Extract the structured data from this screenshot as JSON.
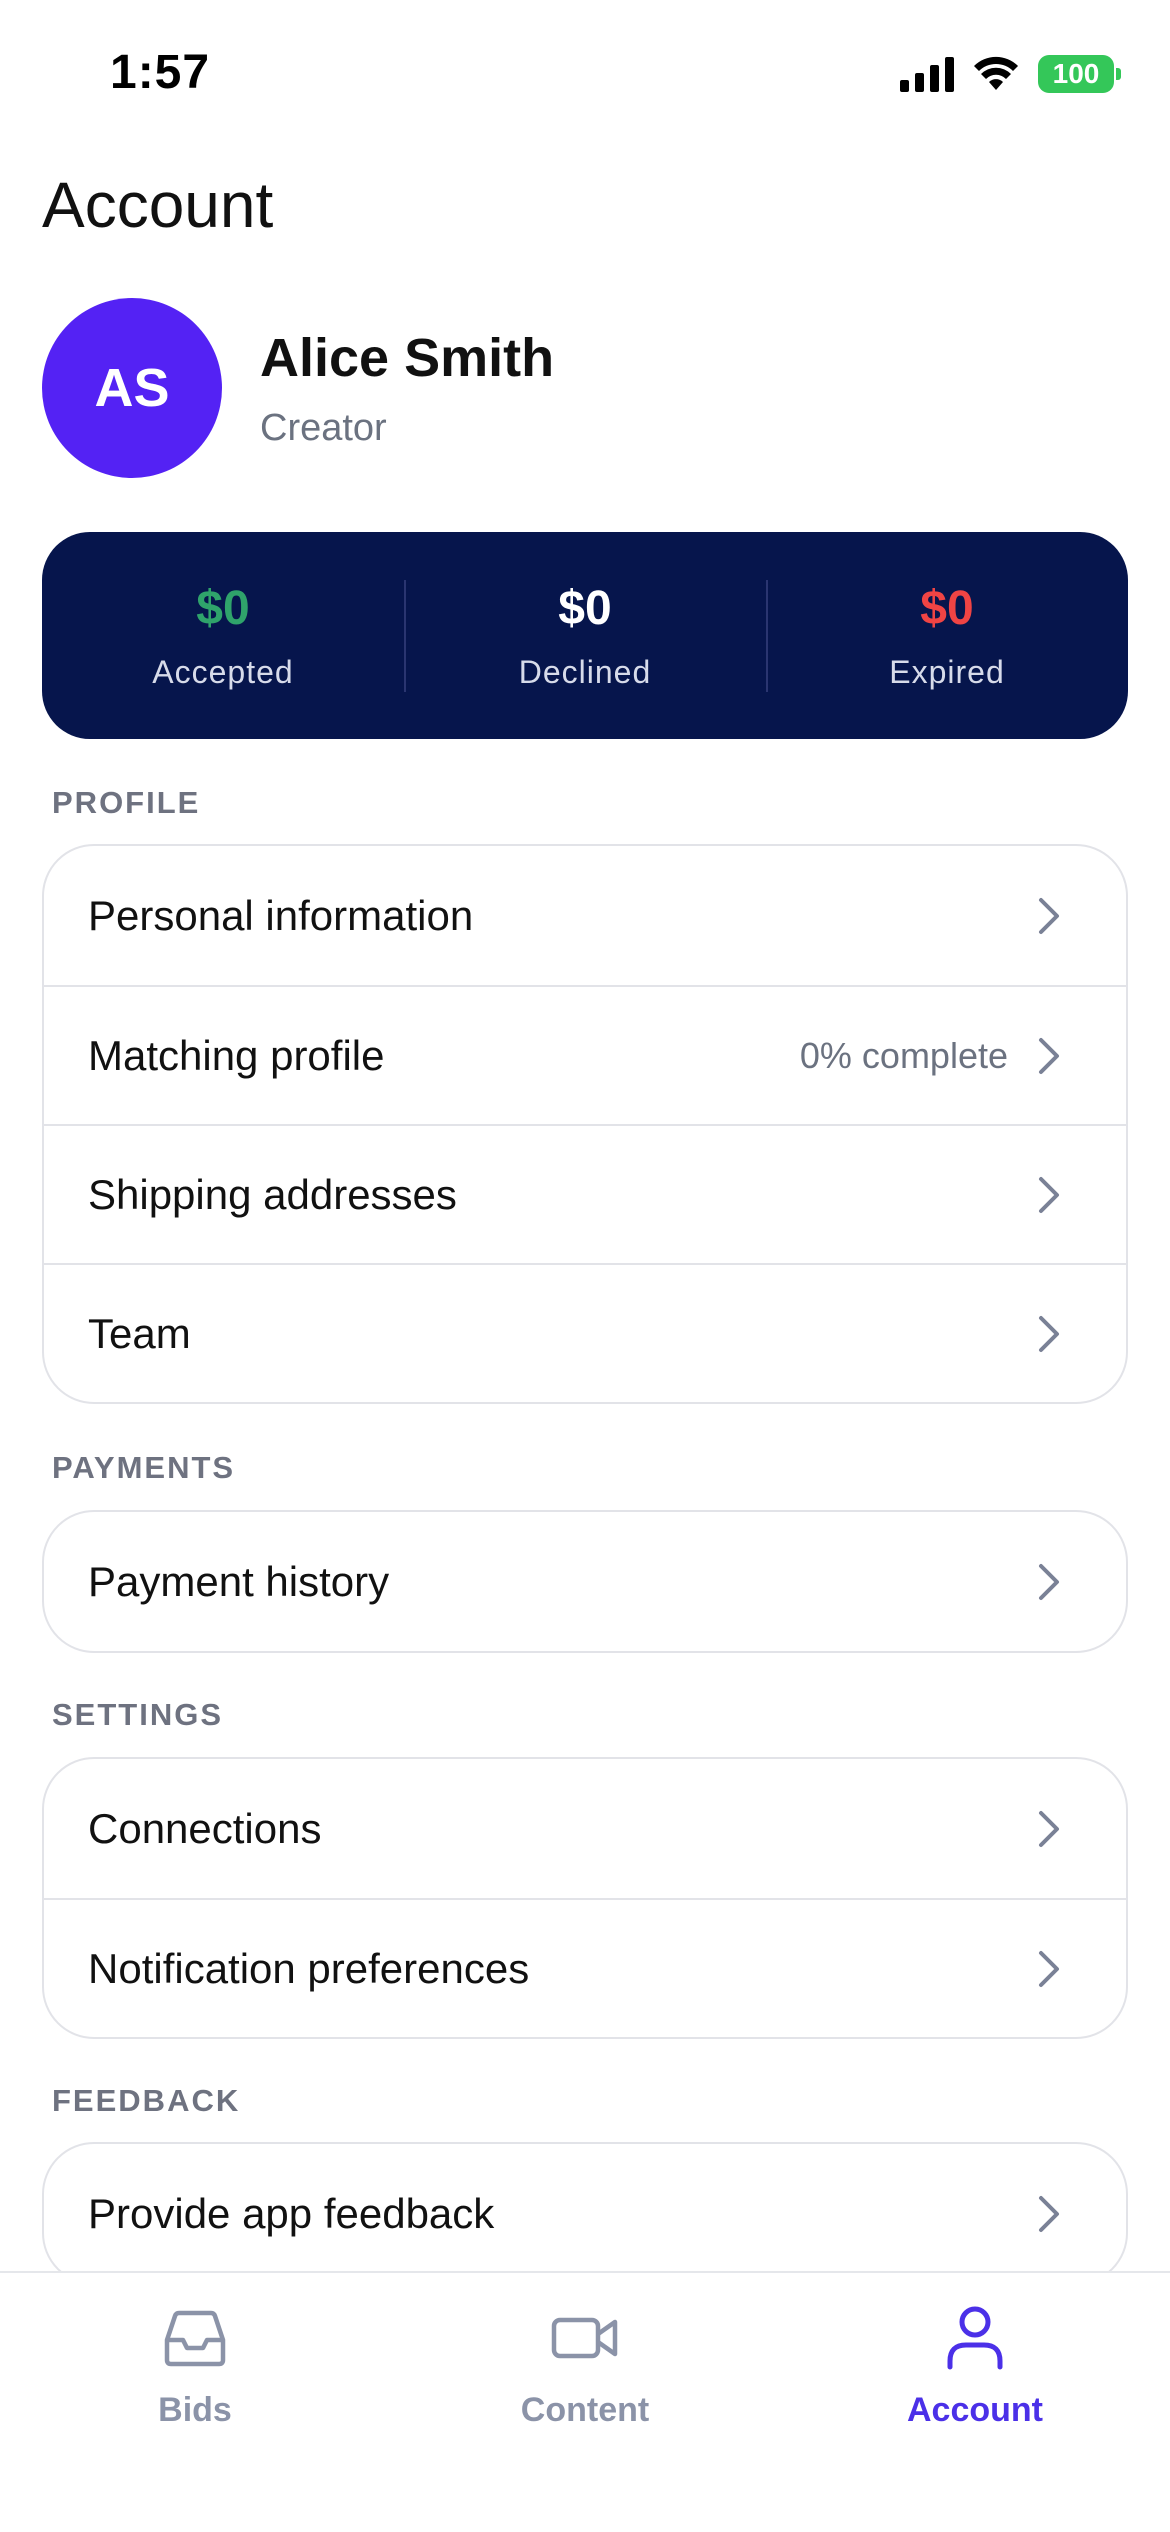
{
  "status_bar": {
    "time": "1:57",
    "battery": "100"
  },
  "header": {
    "title": "Account"
  },
  "profile": {
    "initials": "AS",
    "name": "Alice Smith",
    "role": "Creator"
  },
  "stats": [
    {
      "value": "$0",
      "label": "Accepted",
      "color": "#2fa36b"
    },
    {
      "value": "$0",
      "label": "Declined",
      "color": "#ffffff"
    },
    {
      "value": "$0",
      "label": "Expired",
      "color": "#ef4444"
    }
  ],
  "sections": {
    "profile": {
      "title": "PROFILE",
      "items": [
        {
          "label": "Personal information"
        },
        {
          "label": "Matching profile",
          "meta": "0% complete"
        },
        {
          "label": "Shipping addresses"
        },
        {
          "label": "Team"
        }
      ]
    },
    "payments": {
      "title": "PAYMENTS",
      "items": [
        {
          "label": "Payment history"
        }
      ]
    },
    "settings": {
      "title": "SETTINGS",
      "items": [
        {
          "label": "Connections"
        },
        {
          "label": "Notification preferences"
        }
      ]
    },
    "feedback": {
      "title": "FEEDBACK",
      "items": [
        {
          "label": "Provide app feedback"
        }
      ]
    }
  },
  "tab_bar": {
    "tabs": [
      {
        "label": "Bids",
        "icon": "inbox-icon"
      },
      {
        "label": "Content",
        "icon": "video-camera-icon"
      },
      {
        "label": "Account",
        "icon": "user-icon",
        "active": true
      }
    ]
  },
  "colors": {
    "accent": "#4b30e8",
    "avatar": "#5422f4",
    "stats_bg": "#06154c"
  }
}
